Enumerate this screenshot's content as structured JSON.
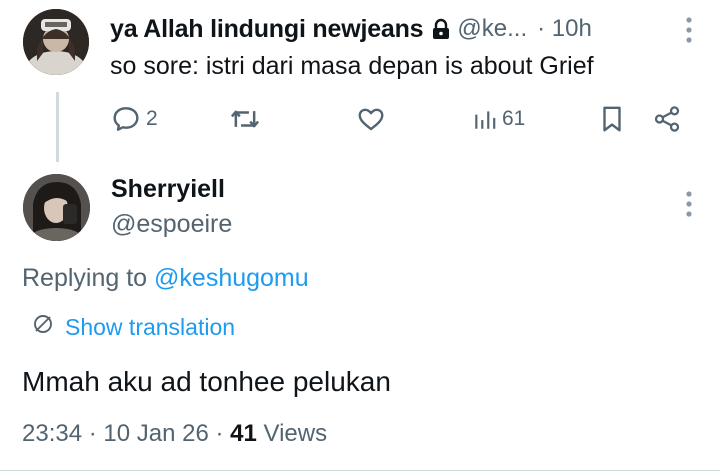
{
  "reply_tweet": {
    "author_name": "ya Allah lindungi newjeans",
    "handle": "@ke...",
    "time": "· 10h",
    "text": "so sore: istri dari masa depan is about Grief",
    "comment_count": "2",
    "views_count": "61"
  },
  "main_tweet": {
    "author_name": "Sherryiell",
    "handle": "@espoeire",
    "replying_prefix": "Replying to ",
    "replying_to": "@keshugomu",
    "translate_label": "Show translation",
    "text": "Mmah aku ad tonhee pelukan",
    "time": "23:34",
    "date": "10 Jan 26",
    "views_count": "41",
    "views_label": "Views"
  },
  "colors": {
    "text_primary": "#0f1419",
    "text_secondary": "#536471",
    "accent": "#1d9bf0",
    "thread_line": "#cfd9de"
  },
  "icons": [
    "lock-icon",
    "more-icon",
    "comment-icon",
    "retweet-icon",
    "like-icon",
    "views-icon",
    "bookmark-icon",
    "share-icon",
    "translate-icon"
  ]
}
